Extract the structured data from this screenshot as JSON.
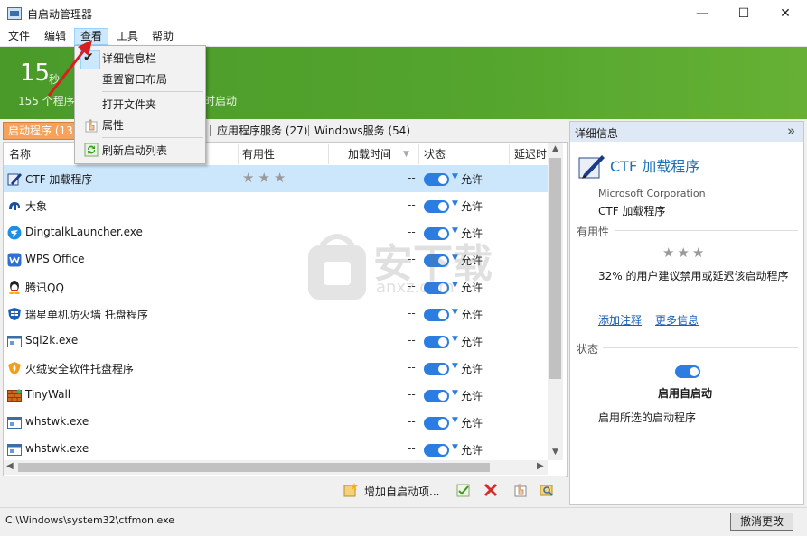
{
  "window": {
    "title": "自启动管理器",
    "min": "—",
    "max": "☐",
    "close": "✕"
  },
  "menu": {
    "file": "文件",
    "edit": "编辑",
    "view": "查看",
    "tools": "工具",
    "help": "帮助"
  },
  "dropdown": {
    "details_bar": "详细信息栏",
    "reset_layout": "重置窗口布局",
    "open_folder": "打开文件夹",
    "properties": "属性",
    "refresh": "刷新启动列表"
  },
  "banner": {
    "big_number": "15",
    "unit": "秒",
    "sub_left": "155 个程序在",
    "sub_right": "时启动"
  },
  "tabs": {
    "startup": "启动程序 (13)",
    "services_app": "应用程序服务 (27)",
    "services_win": "Windows服务 (54)"
  },
  "columns": {
    "name": "名称",
    "usefulness": "有用性",
    "load_time": "加载时间",
    "status": "状态",
    "delay": "延迟时间"
  },
  "rows": [
    {
      "name": "CTF 加载程序",
      "time": "--",
      "status": "允许",
      "icon": "ctf-pen-icon"
    },
    {
      "name": "大象",
      "time": "--",
      "status": "允许",
      "icon": "elephant-icon"
    },
    {
      "name": "DingtalkLauncher.exe",
      "time": "--",
      "status": "允许",
      "icon": "dingtalk-icon"
    },
    {
      "name": "WPS Office",
      "time": "--",
      "status": "允许",
      "icon": "wps-icon"
    },
    {
      "name": "腾讯QQ",
      "time": "--",
      "status": "允许",
      "icon": "qq-penguin-icon"
    },
    {
      "name": "瑞星单机防火墙 托盘程序",
      "time": "--",
      "status": "允许",
      "icon": "firewall-shield-icon"
    },
    {
      "name": "Sql2k.exe",
      "time": "--",
      "status": "允许",
      "icon": "window-app-icon"
    },
    {
      "name": "火绒安全软件托盘程序",
      "time": "--",
      "status": "允许",
      "icon": "huorong-shield-icon"
    },
    {
      "name": "TinyWall",
      "time": "--",
      "status": "允许",
      "icon": "brick-wall-icon"
    },
    {
      "name": "whstwk.exe",
      "time": "--",
      "status": "允许",
      "icon": "window-app-icon"
    },
    {
      "name": "whstwk.exe",
      "time": "--",
      "status": "允许",
      "icon": "window-app-icon"
    }
  ],
  "bottom_toolbar": {
    "add_startup": "增加自启动项..."
  },
  "details": {
    "header": "详细信息",
    "collapse": "»",
    "app_name": "CTF 加载程序",
    "publisher": "Microsoft Corporation",
    "app_name2": "CTF 加载程序",
    "usefulness_label": "有用性",
    "usefulness_text": "32% 的用户建议禁用或延迟该启动程序",
    "add_note": "添加注释",
    "more_info": "更多信息",
    "status_label": "状态",
    "status_title": "启用自启动",
    "status_desc": "启用所选的启动程序"
  },
  "statusbar": {
    "path": "C:\\Windows\\system32\\ctfmon.exe",
    "cancel": "撤消更改"
  },
  "watermark": {
    "text": "安下载",
    "sub": "anxz.com"
  },
  "colors": {
    "banner_green": "#54a52e",
    "tab_orange": "#f7a25a",
    "toggle_blue": "#2b7de1",
    "link_blue": "#1a5fb4"
  }
}
